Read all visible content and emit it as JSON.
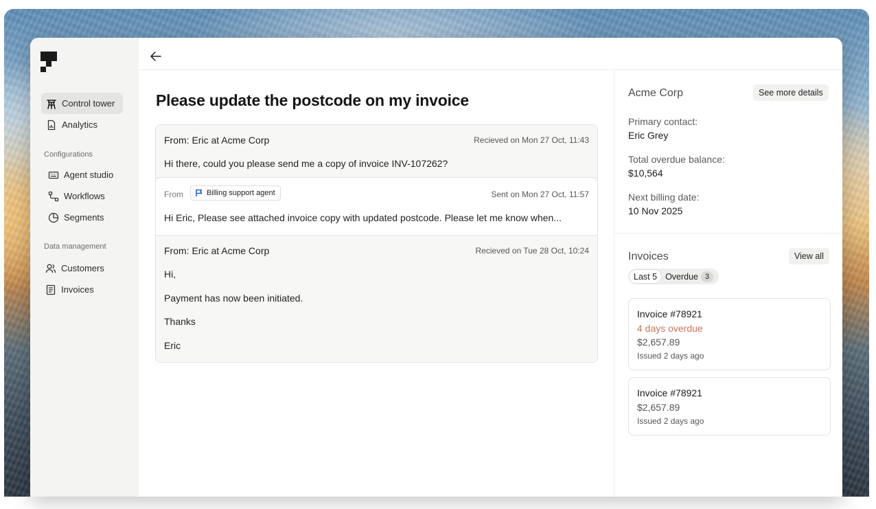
{
  "sidebar": {
    "items": [
      {
        "label": "Control tower"
      },
      {
        "label": "Analytics"
      },
      {
        "label": "Agent studio"
      },
      {
        "label": "Workflows"
      },
      {
        "label": "Segments"
      },
      {
        "label": "Customers"
      },
      {
        "label": "Invoices"
      }
    ],
    "sections": {
      "configurations": "Configurations",
      "data_management": "Data management"
    }
  },
  "page": {
    "title": "Please update the postcode on my invoice"
  },
  "thread": {
    "messages": [
      {
        "from_label": "From:",
        "from": "Eric at Acme Corp",
        "time": "Recieved on Mon 27 Oct, 11:43",
        "body": [
          "Hi there, could you please send me a copy of invoice INV-107262?"
        ]
      },
      {
        "from_label": "From",
        "agent": "Billing support agent",
        "time": "Sent on Mon 27 Oct, 11:57",
        "body": [
          "Hi Eric, Please see attached invoice copy with updated postcode. Please let me know when..."
        ]
      },
      {
        "from_label": "From:",
        "from": "Eric at Acme Corp",
        "time": "Recieved on Tue 28 Oct, 10:24",
        "body": [
          "Hi,",
          "Payment has now been initiated.",
          "Thanks",
          "Eric"
        ]
      }
    ]
  },
  "customer": {
    "name": "Acme Corp",
    "details_button": "See more details",
    "primary_contact_label": "Primary contact:",
    "primary_contact": "Eric Grey",
    "overdue_label": "Total overdue balance:",
    "overdue": "$10,564",
    "billing_label": "Next billing date:",
    "billing_date": "10 Nov 2025"
  },
  "invoices": {
    "title": "Invoices",
    "view_all": "View all",
    "tabs": [
      {
        "label": "Last 5",
        "selected": true
      },
      {
        "label": "Overdue",
        "count": "3"
      }
    ],
    "cards": [
      {
        "title": "Invoice #78921",
        "overdue": "4 days overdue",
        "amount": "$2,657.89",
        "issued": "Issued 2 days ago"
      },
      {
        "title": "Invoice #78921",
        "amount": "$2,657.89",
        "issued": "Issued 2 days ago"
      }
    ]
  },
  "colors": {
    "overdue": "#c8765a",
    "sidebar_bg": "#f4f4f3"
  }
}
